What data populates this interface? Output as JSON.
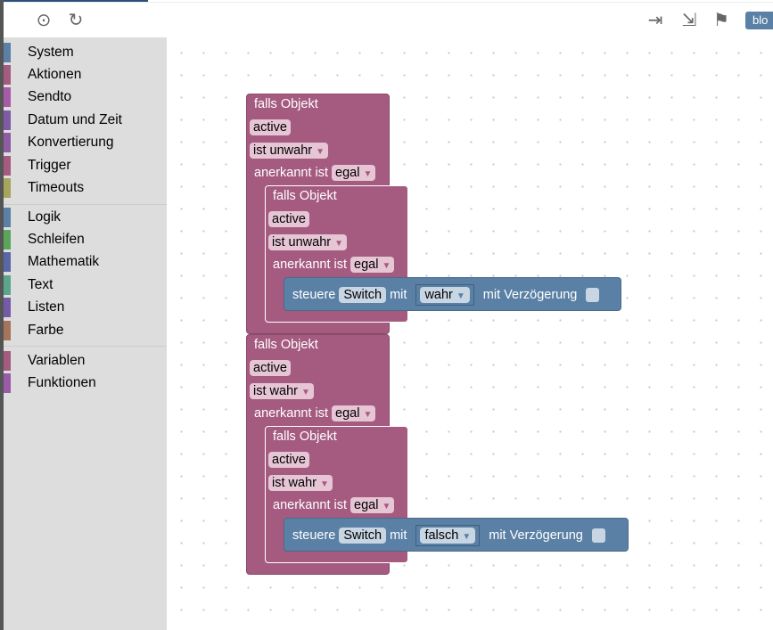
{
  "toolbar": {
    "icons": [
      "locate-icon",
      "refresh-icon",
      "export-icon",
      "import-icon",
      "checkered-flag-icon",
      "blockly-icon"
    ],
    "blockly_label": "blo"
  },
  "sidebar": {
    "groups": [
      [
        {
          "label": "System",
          "color": "#5b80a5"
        },
        {
          "label": "Aktionen",
          "color": "#a55b80"
        },
        {
          "label": "Sendto",
          "color": "#a55ba5"
        },
        {
          "label": "Datum und Zeit",
          "color": "#805ba5"
        },
        {
          "label": "Konvertierung",
          "color": "#8e5ba5"
        },
        {
          "label": "Trigger",
          "color": "#a55b80"
        },
        {
          "label": "Timeouts",
          "color": "#a5a55b"
        }
      ],
      [
        {
          "label": "Logik",
          "color": "#5b80a5"
        },
        {
          "label": "Schleifen",
          "color": "#5ba55b"
        },
        {
          "label": "Mathematik",
          "color": "#5b67a5"
        },
        {
          "label": "Text",
          "color": "#5ba58c"
        },
        {
          "label": "Listen",
          "color": "#745ba5"
        },
        {
          "label": "Farbe",
          "color": "#a5745b"
        }
      ],
      [
        {
          "label": "Variablen",
          "color": "#a55b80"
        },
        {
          "label": "Funktionen",
          "color": "#995ba5"
        }
      ]
    ]
  },
  "blocks": [
    {
      "outer": {
        "title": "falls Objekt",
        "object": "active",
        "condition": "ist unwahr",
        "ack_label": "anerkannt ist",
        "ack": "egal"
      },
      "inner": {
        "title": "falls Objekt",
        "object": "active",
        "condition": "ist unwahr",
        "ack_label": "anerkannt ist",
        "ack": "egal"
      },
      "action": {
        "label": "steuere",
        "target": "Switch",
        "with": "mit",
        "value": "wahr",
        "delay_label": "mit Verzögerung"
      }
    },
    {
      "outer": {
        "title": "falls Objekt",
        "object": "active",
        "condition": "ist wahr",
        "ack_label": "anerkannt ist",
        "ack": "egal"
      },
      "inner": {
        "title": "falls Objekt",
        "object": "active",
        "condition": "ist wahr",
        "ack_label": "anerkannt ist",
        "ack": "egal"
      },
      "action": {
        "label": "steuere",
        "target": "Switch",
        "with": "mit",
        "value": "falsch",
        "delay_label": "mit Verzögerung"
      }
    }
  ],
  "colors": {
    "block_pink": "#a55b80",
    "block_blue": "#5b80a5"
  }
}
